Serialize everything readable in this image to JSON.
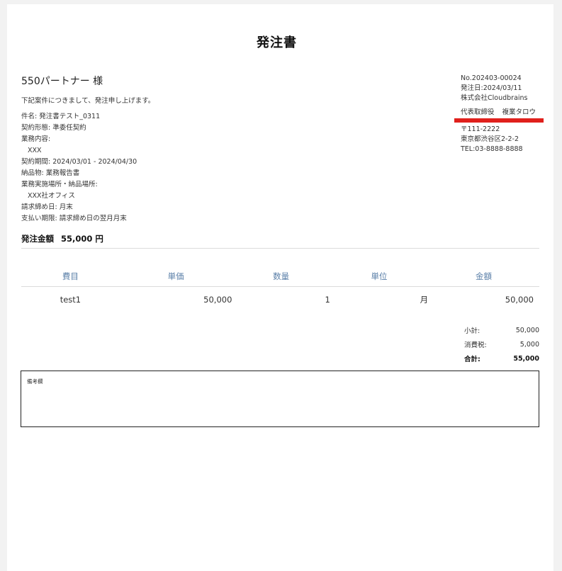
{
  "document": {
    "title": "発注書",
    "recipient": "550パートナー 様",
    "intro": "下記案件につきまして、発注申し上げます。"
  },
  "details": [
    {
      "text": "件名: 発注書テスト_0311",
      "indent": false
    },
    {
      "text": "契約形態: 準委任契約",
      "indent": false
    },
    {
      "text": "業務内容:",
      "indent": false
    },
    {
      "text": "XXX",
      "indent": true
    },
    {
      "text": "契約期間: 2024/03/01 - 2024/04/30",
      "indent": false
    },
    {
      "text": "納品物: 業務報告書",
      "indent": false
    },
    {
      "text": "業務実施場所・納品場所:",
      "indent": false
    },
    {
      "text": "XXX社オフィス",
      "indent": true
    },
    {
      "text": "請求締め日: 月末",
      "indent": false
    },
    {
      "text": "支払い期限: 請求締め日の翌月月末",
      "indent": false
    }
  ],
  "amount": {
    "label": "発注金額",
    "value": "55,000 円"
  },
  "issuer": {
    "number": "No.202403-00024",
    "date": "発注日:2024/03/11",
    "company": "株式会社Cloudbrains",
    "rep_title": "代表取締役",
    "rep_name": "複業タロウ",
    "postal": "〒111-2222",
    "address": "東京都渋谷区2-2-2",
    "tel": "TEL:03-8888-8888"
  },
  "table": {
    "headers": [
      "費目",
      "単価",
      "数量",
      "単位",
      "金額"
    ],
    "rows": [
      [
        "test1",
        "50,000",
        "1",
        "月",
        "50,000"
      ]
    ]
  },
  "totals": {
    "subtotal_label": "小計:",
    "subtotal": "50,000",
    "tax_label": "消費税:",
    "tax": "5,000",
    "total_label": "合計:",
    "total": "55,000"
  },
  "notes": {
    "label": "備考欄"
  },
  "colors": {
    "header_text": "#5a7fa8",
    "highlight": "#e0201c"
  }
}
